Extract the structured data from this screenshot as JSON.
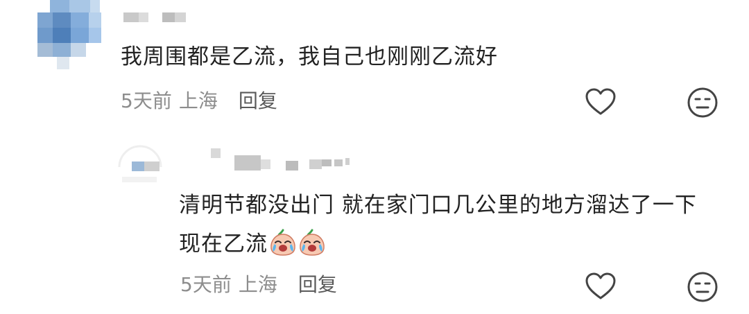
{
  "comment": {
    "text": "我周围都是乙流，我自己也刚刚乙流好",
    "time": "5天前",
    "location": "上海",
    "reply_label": "回复",
    "icons": {
      "like": "heart-outline-icon",
      "dislike": "neutral-face-icon"
    }
  },
  "reply": {
    "text": "清明节都没出门 就在家门口几公里的地方溜达了一下 现在乙流",
    "emoji": [
      "crying-laugh-sticker",
      "crying-laugh-sticker"
    ],
    "time": "5天前",
    "location": "上海",
    "reply_label": "回复",
    "icons": {
      "like": "heart-outline-icon",
      "dislike": "neutral-face-icon"
    }
  },
  "colors": {
    "text": "#222222",
    "meta": "#8d8d8d",
    "reply_button": "#5a5a5a",
    "icon_stroke": "#444444"
  }
}
